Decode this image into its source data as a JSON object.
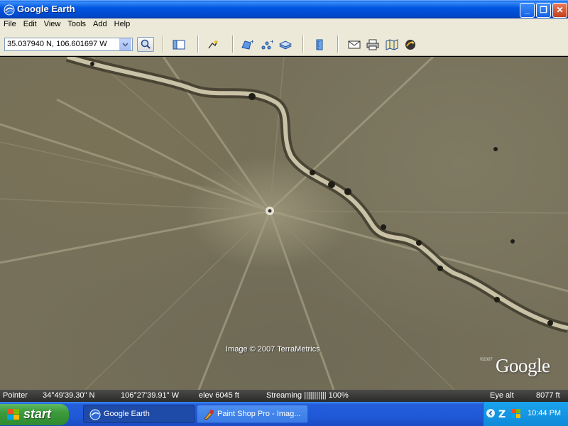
{
  "window": {
    "title": "Google Earth",
    "controls": {
      "minimize": "_",
      "maximize": "❐",
      "close": "✕"
    }
  },
  "menu": [
    "File",
    "Edit",
    "View",
    "Tools",
    "Add",
    "Help"
  ],
  "toolbar": {
    "search_value": "35.037940 N, 106.601697 W",
    "icons": [
      "sidebar-icon",
      "placemark-icon",
      "polygon-icon",
      "path-icon",
      "overlay-icon",
      "ruler-icon",
      "email-icon",
      "print-icon",
      "map-icon",
      "sky-icon"
    ]
  },
  "map": {
    "copyright": "Image © 2007 TerraMetrics",
    "brand": "Google",
    "brand_year": "©2007"
  },
  "status": {
    "pointer_label": "Pointer",
    "lat": "34°49'39.30\" N",
    "lon": "106°27'39.91\" W",
    "elev": "elev  6045 ft",
    "streaming": "Streaming  |||||||||||  100%",
    "eye_alt_label": "Eye alt",
    "eye_alt_value": "8077 ft"
  },
  "taskbar": {
    "start": "start",
    "tasks": [
      {
        "label": "Google Earth",
        "active": true
      },
      {
        "label": "Paint Shop Pro - Imag...",
        "active": false
      }
    ],
    "clock": "10:44 PM"
  },
  "colors": {
    "title_blue": "#0056e0",
    "start_green": "#3c9a3c",
    "tray_blue": "#0f8ad9"
  }
}
